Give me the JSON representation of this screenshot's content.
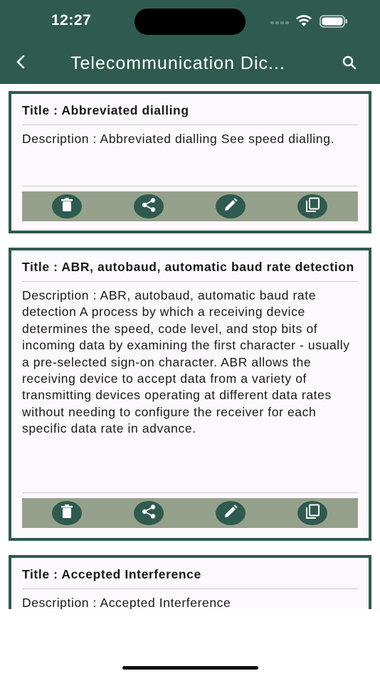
{
  "status_bar": {
    "time": "12:27"
  },
  "toolbar": {
    "title": "Telecommunication Dic...",
    "back_icon": "chevron-left-icon",
    "search_icon": "search-icon"
  },
  "colors": {
    "primary": "#2f5a4f",
    "action_bar": "#96a18b",
    "card_background": "#fcf8fc"
  },
  "entries": [
    {
      "title": "Title : Abbreviated dialling",
      "description": "Description : Abbreviated dialling See speed dialling."
    },
    {
      "title": "Title : ABR, autobaud, automatic baud rate detection",
      "description": "Description : ABR, autobaud, automatic baud rate detection A process by which a receiving device determines the speed, code level, and stop bits of incoming data by examining the first character - usually a pre-selected sign-on character. ABR allows the receiving device to accept data from a variety of transmitting devices operating at different data rates without needing to configure the receiver for each specific data rate in advance."
    },
    {
      "title": "Title : Accepted Interference",
      "description": "Description : Accepted Interference"
    }
  ],
  "actions": [
    "delete-icon",
    "share-icon",
    "edit-icon",
    "copy-icon"
  ]
}
